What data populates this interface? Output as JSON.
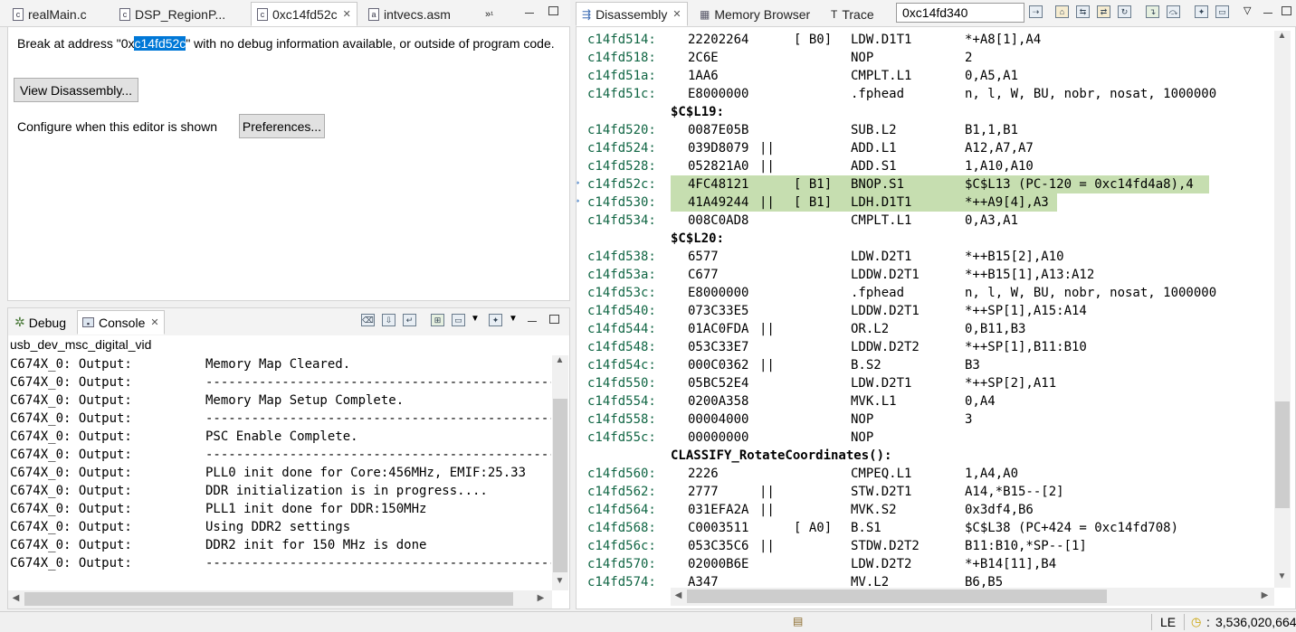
{
  "editor_tabs": [
    {
      "label": "realMain.c",
      "icon": "c-file-icon"
    },
    {
      "label": "DSP_RegionP...",
      "icon": "c-file-icon"
    },
    {
      "label": "0xc14fd52c",
      "icon": "c-file-icon",
      "active": true
    },
    {
      "label": "intvecs.asm",
      "icon": "asm-file-icon"
    }
  ],
  "editor_overflow": "¹",
  "editor": {
    "msg_before": "Break at address \"0x",
    "msg_selected": "c14fd52c",
    "msg_after": "\" with no debug information available, or outside of program code.",
    "view_button": "View Disassembly...",
    "configure_label": "Configure when this editor is shown",
    "preferences_button": "Preferences..."
  },
  "console_tabs": [
    {
      "label": "Debug",
      "icon": "debug-icon"
    },
    {
      "label": "Console",
      "icon": "console-icon",
      "active": true
    }
  ],
  "console": {
    "title": "usb_dev_msc_digital_vid",
    "lines": [
      {
        "src": "C674X_0: Output:",
        "text": "Memory Map Cleared."
      },
      {
        "src": "C674X_0: Output:",
        "text": "-----------------------------------------------"
      },
      {
        "src": "C674X_0: Output:",
        "text": "Memory Map Setup Complete."
      },
      {
        "src": "C674X_0: Output:",
        "text": "-----------------------------------------------"
      },
      {
        "src": "C674X_0: Output:",
        "text": "PSC Enable Complete."
      },
      {
        "src": "C674X_0: Output:",
        "text": "-----------------------------------------------"
      },
      {
        "src": "C674X_0: Output:",
        "text": "PLL0 init done for Core:456MHz, EMIF:25.33"
      },
      {
        "src": "C674X_0: Output:",
        "text": "DDR initialization is in progress...."
      },
      {
        "src": "C674X_0: Output:",
        "text": "PLL1 init done for DDR:150MHz"
      },
      {
        "src": "C674X_0: Output:",
        "text": "Using DDR2 settings"
      },
      {
        "src": "C674X_0: Output:",
        "text": "DDR2 init for 150 MHz is done"
      },
      {
        "src": "C674X_0: Output:",
        "text": "-----------------------------------------------"
      }
    ]
  },
  "right_tabs": [
    {
      "label": "Disassembly",
      "icon": "disassembly-icon",
      "active": true
    },
    {
      "label": "Memory Browser",
      "icon": "memory-icon"
    },
    {
      "label": "Trace",
      "icon": "trace-icon"
    }
  ],
  "address_input": "0xc14fd340",
  "disassembly": [
    {
      "addr": "c14fd514:",
      "opc": "22202264",
      "par": "",
      "pred": "[ B0]",
      "mnem": "LDW.D1T1",
      "oper": "*+A8[1],A4"
    },
    {
      "addr": "c14fd518:",
      "opc": "2C6E",
      "par": "",
      "pred": "",
      "mnem": "NOP",
      "oper": "2"
    },
    {
      "addr": "c14fd51a:",
      "opc": "1AA6",
      "par": "",
      "pred": "",
      "mnem": "CMPLT.L1",
      "oper": "0,A5,A1"
    },
    {
      "addr": "c14fd51c:",
      "opc": "E8000000",
      "par": "",
      "pred": "",
      "mnem": ".fphead",
      "oper": "n, l, W, BU, nobr, nosat, 1000000"
    },
    {
      "label": "$C$L19:"
    },
    {
      "addr": "c14fd520:",
      "opc": "0087E05B",
      "par": "",
      "pred": "",
      "mnem": "SUB.L2",
      "oper": "B1,1,B1"
    },
    {
      "addr": "c14fd524:",
      "opc": "039D8079",
      "par": "||",
      "pred": "",
      "mnem": "ADD.L1",
      "oper": "A12,A7,A7"
    },
    {
      "addr": "c14fd528:",
      "opc": "052821A0",
      "par": "||",
      "pred": "",
      "mnem": "ADD.S1",
      "oper": "1,A10,A10"
    },
    {
      "addr": "c14fd52c:",
      "opc": "4FC48121",
      "par": "",
      "pred": "[ B1]",
      "mnem": "BNOP.S1",
      "oper": "$C$L13 (PC-120 = 0xc14fd4a8),4",
      "hl": "wide",
      "mark": true
    },
    {
      "addr": "c14fd530:",
      "opc": "41A49244",
      "par": "||",
      "pred": "[ B1]",
      "mnem": "LDH.D1T1",
      "oper": "*++A9[4],A3",
      "hl": "mid",
      "mark": true
    },
    {
      "addr": "c14fd534:",
      "opc": "008C0AD8",
      "par": "",
      "pred": "",
      "mnem": "CMPLT.L1",
      "oper": "0,A3,A1"
    },
    {
      "label": "$C$L20:"
    },
    {
      "addr": "c14fd538:",
      "opc": "6577",
      "par": "",
      "pred": "",
      "mnem": "LDW.D2T1",
      "oper": "*++B15[2],A10"
    },
    {
      "addr": "c14fd53a:",
      "opc": "C677",
      "par": "",
      "pred": "",
      "mnem": "LDDW.D2T1",
      "oper": "*++B15[1],A13:A12"
    },
    {
      "addr": "c14fd53c:",
      "opc": "E8000000",
      "par": "",
      "pred": "",
      "mnem": ".fphead",
      "oper": "n, l, W, BU, nobr, nosat, 1000000"
    },
    {
      "addr": "c14fd540:",
      "opc": "073C33E5",
      "par": "",
      "pred": "",
      "mnem": "LDDW.D2T1",
      "oper": "*++SP[1],A15:A14"
    },
    {
      "addr": "c14fd544:",
      "opc": "01AC0FDA",
      "par": "||",
      "pred": "",
      "mnem": "OR.L2",
      "oper": "0,B11,B3"
    },
    {
      "addr": "c14fd548:",
      "opc": "053C33E7",
      "par": "",
      "pred": "",
      "mnem": "LDDW.D2T2",
      "oper": "*++SP[1],B11:B10"
    },
    {
      "addr": "c14fd54c:",
      "opc": "000C0362",
      "par": "||",
      "pred": "",
      "mnem": "B.S2",
      "oper": "B3"
    },
    {
      "addr": "c14fd550:",
      "opc": "05BC52E4",
      "par": "",
      "pred": "",
      "mnem": "LDW.D2T1",
      "oper": "*++SP[2],A11"
    },
    {
      "addr": "c14fd554:",
      "opc": "0200A358",
      "par": "",
      "pred": "",
      "mnem": "MVK.L1",
      "oper": "0,A4"
    },
    {
      "addr": "c14fd558:",
      "opc": "00004000",
      "par": "",
      "pred": "",
      "mnem": "NOP",
      "oper": "3"
    },
    {
      "addr": "c14fd55c:",
      "opc": "00000000",
      "par": "",
      "pred": "",
      "mnem": "NOP",
      "oper": ""
    },
    {
      "label": "CLASSIFY_RotateCoordinates():"
    },
    {
      "addr": "c14fd560:",
      "opc": "2226",
      "par": "",
      "pred": "",
      "mnem": "CMPEQ.L1",
      "oper": "1,A4,A0"
    },
    {
      "addr": "c14fd562:",
      "opc": "2777",
      "par": "||",
      "pred": "",
      "mnem": "STW.D2T1",
      "oper": "A14,*B15--[2]"
    },
    {
      "addr": "c14fd564:",
      "opc": "031EFA2A",
      "par": "||",
      "pred": "",
      "mnem": "MVK.S2",
      "oper": "0x3df4,B6"
    },
    {
      "addr": "c14fd568:",
      "opc": "C0003511",
      "par": "",
      "pred": "[ A0]",
      "mnem": "B.S1",
      "oper": "$C$L38 (PC+424 = 0xc14fd708)"
    },
    {
      "addr": "c14fd56c:",
      "opc": "053C35C6",
      "par": "||",
      "pred": "",
      "mnem": "STDW.D2T2",
      "oper": "B11:B10,*SP--[1]"
    },
    {
      "addr": "c14fd570:",
      "opc": "02000B6E",
      "par": "",
      "pred": "",
      "mnem": "LDW.D2T2",
      "oper": "*+B14[11],B4"
    },
    {
      "addr": "c14fd574:",
      "opc": "A347",
      "par": "",
      "pred": "",
      "mnem": "MV.L2",
      "oper": "B6,B5"
    }
  ],
  "status": {
    "endian": "LE",
    "cycles": "3,536,020,664"
  }
}
